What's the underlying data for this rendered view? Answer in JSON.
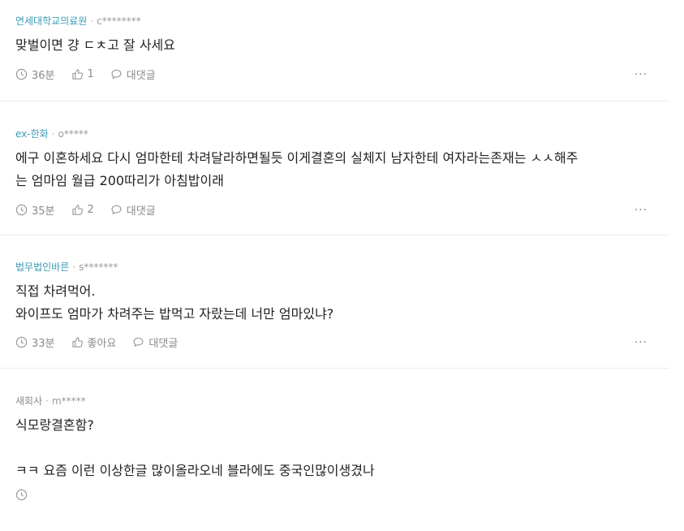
{
  "comments": [
    {
      "company": "연세대학교의료원",
      "user": "c********",
      "lines": [
        "맞벌이면 걍 ㄷㅊ고 잘 사세요"
      ],
      "time": "36분",
      "likes": "1",
      "reply_label": "대댓글"
    },
    {
      "company": "ex-한화",
      "user": "o*****",
      "lines": [
        "에구 이혼하세요 다시 엄마한테 차려달라하면될듯 이게결혼의 실체지 남자한테 여자라는존재는 ㅅㅅ해주",
        "는 엄마임 월급 200따리가 아침밥이래"
      ],
      "time": "35분",
      "likes": "2",
      "reply_label": "대댓글"
    },
    {
      "company": "법무법인바른",
      "user": "s*******",
      "lines": [
        "직접 차려먹어.",
        "와이프도 엄마가 차려주는 밥먹고 자랐는데 너만 엄마있냐?"
      ],
      "time": "33분",
      "likes": "좋아요",
      "reply_label": "대댓글"
    },
    {
      "company": "새회사",
      "user": "m*****",
      "lines": [
        "식모랑결혼함?",
        "",
        "ㅋㅋ 요즘 이런 이상한글 많이올라오네 블라에도 중국인많이생겼나"
      ]
    }
  ],
  "meta_separator": "·",
  "more_label": "···",
  "colors": {
    "company": "#3a9ab5",
    "company_muted": "#8a8a8a",
    "divider": "#ececec"
  }
}
